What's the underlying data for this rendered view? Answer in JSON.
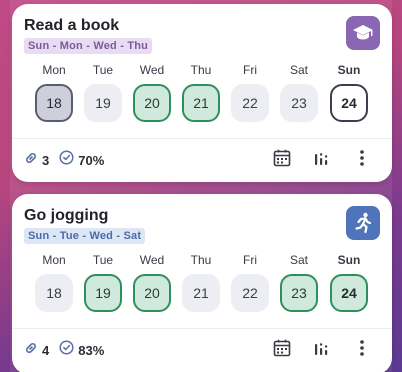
{
  "colors": {
    "accent_done": "#2f8f5c",
    "accent_purple": "#8a67b3",
    "accent_blue": "#4f74b9"
  },
  "habits": [
    {
      "title": "Read a book",
      "days_label": "Sun - Mon - Wed - Thu",
      "icon": "graduation-cap-icon",
      "week": [
        {
          "name": "Mon",
          "date": "18",
          "state": "selected"
        },
        {
          "name": "Tue",
          "date": "19",
          "state": "none"
        },
        {
          "name": "Wed",
          "date": "20",
          "state": "done"
        },
        {
          "name": "Thu",
          "date": "21",
          "state": "done"
        },
        {
          "name": "Fri",
          "date": "22",
          "state": "none"
        },
        {
          "name": "Sat",
          "date": "23",
          "state": "none"
        },
        {
          "name": "Sun",
          "date": "24",
          "state": "today"
        }
      ],
      "streak": "3",
      "completion": "70%"
    },
    {
      "title": "Go jogging",
      "days_label": "Sun - Tue - Wed - Sat",
      "icon": "running-icon",
      "week": [
        {
          "name": "Mon",
          "date": "18",
          "state": "none"
        },
        {
          "name": "Tue",
          "date": "19",
          "state": "done"
        },
        {
          "name": "Wed",
          "date": "20",
          "state": "done"
        },
        {
          "name": "Thu",
          "date": "21",
          "state": "none"
        },
        {
          "name": "Fri",
          "date": "22",
          "state": "none"
        },
        {
          "name": "Sat",
          "date": "23",
          "state": "done"
        },
        {
          "name": "Sun",
          "date": "24",
          "state": "today-done"
        }
      ],
      "streak": "4",
      "completion": "83%"
    }
  ]
}
